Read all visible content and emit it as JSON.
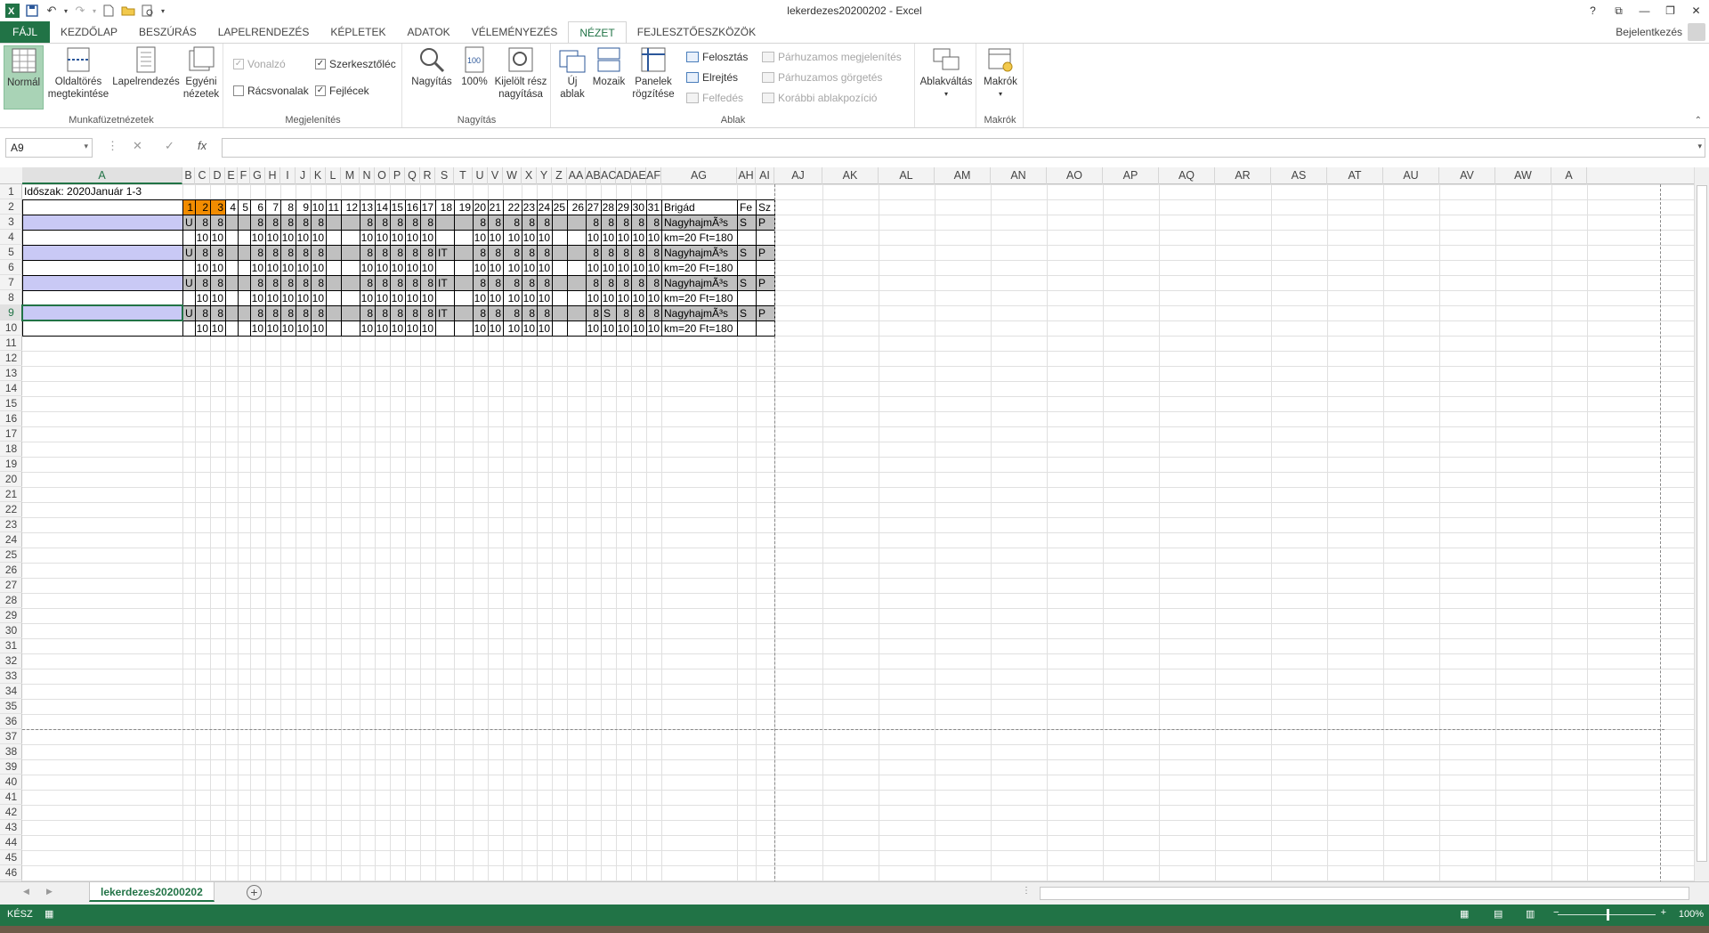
{
  "window": {
    "title": "lekerdezes20200202 - Excel",
    "help": "?",
    "ribbon_options": "⧉",
    "minimize": "—",
    "restore": "❐",
    "close": "✕"
  },
  "tabs": [
    {
      "label": "FÁJL"
    },
    {
      "label": "KEZDŐLAP"
    },
    {
      "label": "BESZÚRÁS"
    },
    {
      "label": "LAPELRENDEZÉS"
    },
    {
      "label": "KÉPLETEK"
    },
    {
      "label": "ADATOK"
    },
    {
      "label": "VÉLEMÉNYEZÉS"
    },
    {
      "label": "NÉZET"
    },
    {
      "label": "FEJLESZTŐESZKÖZÖK"
    }
  ],
  "signin": "Bejelentkezés",
  "ribbon": {
    "g1": {
      "label": "Munkafüzetnézetek",
      "normal": "Normál",
      "pagebreak1": "Oldaltörés",
      "pagebreak2": "megtekintése",
      "layout": "Lapelrendezés",
      "custom1": "Egyéni",
      "custom2": "nézetek"
    },
    "g2": {
      "label": "Megjelenítés",
      "ruler": "Vonalzó",
      "gridlines": "Rácsvonalak",
      "formulabar": "Szerkesztőléc",
      "headings": "Fejlécek"
    },
    "g3": {
      "label": "Nagyítás",
      "zoom": "Nagyítás",
      "zoom100": "100%",
      "sel1": "Kijelölt rész",
      "sel2": "nagyítása"
    },
    "g4": {
      "label": "Ablak",
      "new1": "Új",
      "new2": "ablak",
      "arrange": "Mozaik",
      "freeze1": "Panelek",
      "freeze2": "rögzítése",
      "split": "Felosztás",
      "hide": "Elrejtés",
      "unhide": "Felfedés",
      "sbs": "Párhuzamos megjelenítés",
      "sync": "Párhuzamos görgetés",
      "reset": "Korábbi ablakpozíció",
      "switch": "Ablakváltás"
    },
    "g5": {
      "label": "Makrók",
      "macros": "Makrók"
    }
  },
  "formulabar": {
    "namebox": "A9",
    "fx": "fx",
    "cancel": "✕",
    "enter": "✓",
    "value": ""
  },
  "columns": [
    "A",
    "B",
    "C",
    "D",
    "E",
    "F",
    "G",
    "H",
    "I",
    "J",
    "K",
    "L",
    "M",
    "N",
    "O",
    "P",
    "Q",
    "R",
    "S",
    "T",
    "U",
    "V",
    "W",
    "X",
    "Y",
    "Z",
    "AA",
    "AB",
    "AC",
    "AD",
    "AE",
    "AF",
    "AG",
    "AH",
    "AI",
    "AJ",
    "AK",
    "AL",
    "AM",
    "AN",
    "AO",
    "AP",
    "AQ",
    "AR",
    "AS",
    "AT",
    "AU",
    "AV",
    "AW",
    "A"
  ],
  "sheet": {
    "a1": "Időszak: 2020Január 1-3",
    "days": [
      "1",
      "2",
      "3",
      "4",
      "5",
      "6",
      "7",
      "8",
      "9",
      "10",
      "11",
      "12",
      "13",
      "14",
      "15",
      "16",
      "17",
      "18",
      "19",
      "20",
      "21",
      "22",
      "23",
      "24",
      "25",
      "26",
      "27",
      "28",
      "29",
      "30",
      "31"
    ],
    "brigad": "Brigád",
    "fe": "Fe",
    "sz": "Sz",
    "odd_row_code": "U",
    "odd_row_vals": [
      "",
      "8",
      "8",
      "",
      "",
      "8",
      "8",
      "8",
      "8",
      "8",
      "",
      "",
      "8",
      "8",
      "8",
      "8",
      "8",
      "",
      "",
      "8",
      "8",
      "8",
      "8",
      "8",
      "",
      "",
      "8",
      "8",
      "8",
      "8",
      "8"
    ],
    "even_row_vals": [
      "",
      "10",
      "10",
      "",
      "",
      "10",
      "10",
      "10",
      "10",
      "10",
      "",
      "",
      "10",
      "10",
      "10",
      "10",
      "10",
      "",
      "",
      "10",
      "10",
      "10",
      "10",
      "10",
      "",
      "",
      "10",
      "10",
      "10",
      "10",
      "10"
    ],
    "nagy": "NagyhajmÃ³s",
    "km": "km=20 Ft=180",
    "s": "S",
    "p": "P",
    "it": "IT"
  },
  "sheet_tab": "lekerdezes20200202",
  "add_sheet": "+",
  "status": {
    "text": "KÉSZ",
    "zoom": "100%",
    "zoom_percent": 100
  }
}
